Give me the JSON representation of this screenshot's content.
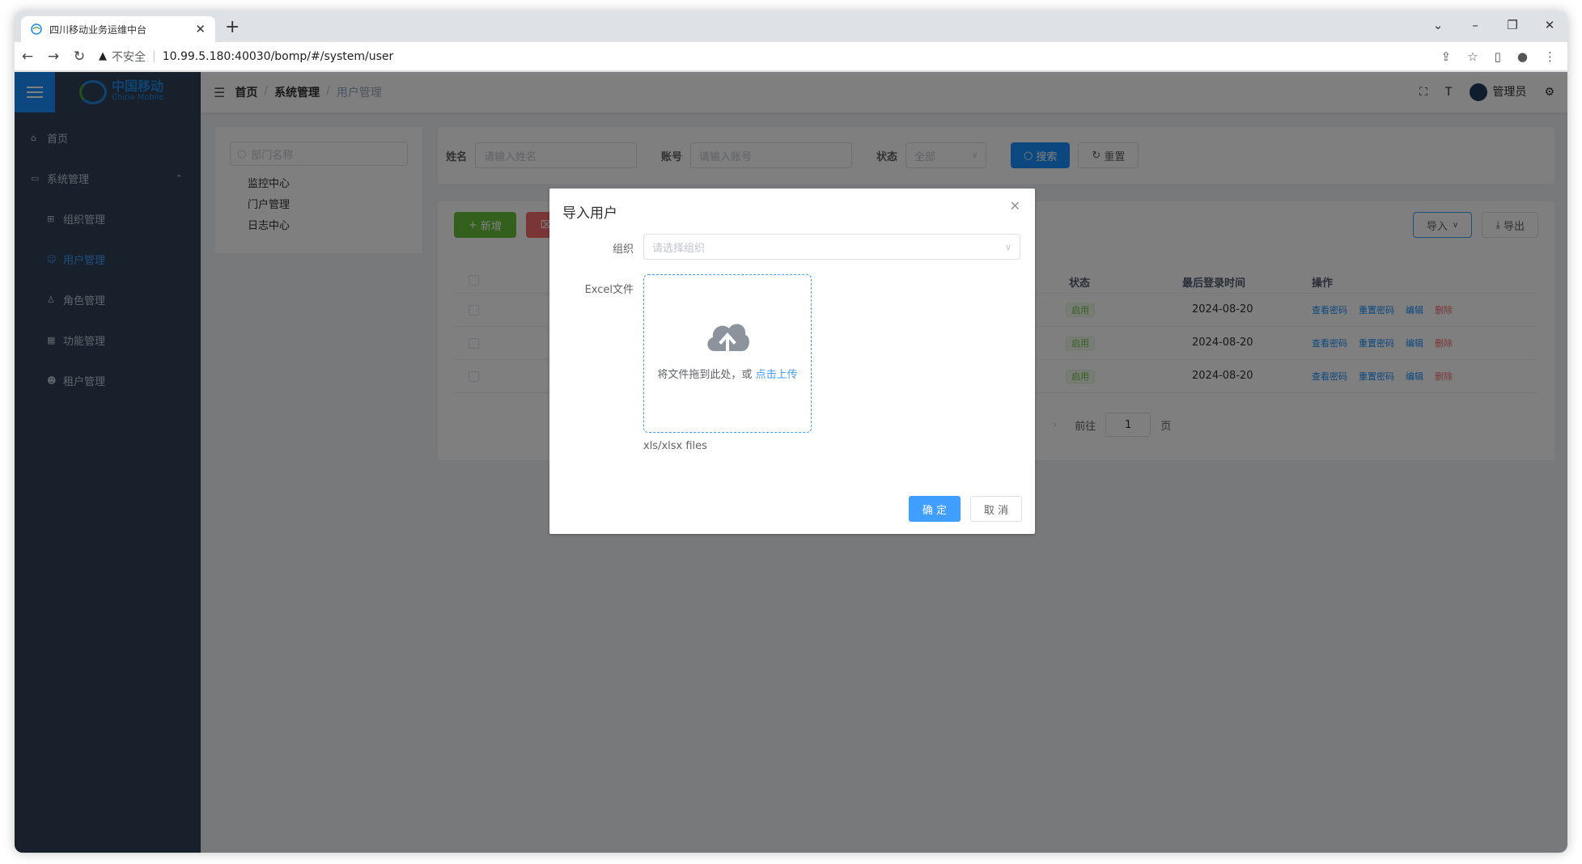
{
  "browser": {
    "tab_title": "四川移动业务运维中台",
    "url_warning": "不安全",
    "url": "10.99.5.180:40030/bomp/#/system/user"
  },
  "logo": {
    "cn": "中国移动",
    "en": "China Mobile"
  },
  "sidebar": {
    "items": [
      {
        "label": "首页"
      },
      {
        "label": "系统管理"
      },
      {
        "label": "组织管理"
      },
      {
        "label": "用户管理"
      },
      {
        "label": "角色管理"
      },
      {
        "label": "功能管理"
      },
      {
        "label": "租户管理"
      }
    ]
  },
  "breadcrumb": [
    "首页",
    "系统管理",
    "用户管理"
  ],
  "navbar": {
    "user": "管理员"
  },
  "dept": {
    "placeholder": "部门名称",
    "nodes": [
      "监控中心",
      "门户管理",
      "日志中心"
    ]
  },
  "search": {
    "name_label": "姓名",
    "name_placeholder": "请输入姓名",
    "account_label": "账号",
    "account_placeholder": "请输入账号",
    "status_label": "状态",
    "status_value": "全部",
    "search_btn": "搜索",
    "reset_btn": "重置"
  },
  "toolbar": {
    "add": "新增",
    "import": "导入",
    "export": "导出"
  },
  "table": {
    "headers": {
      "status": "状态",
      "last_login": "最后登录时间",
      "ops": "操作"
    },
    "rows": [
      {
        "status": "启用",
        "last_login": "2024-08-20"
      },
      {
        "status": "启用",
        "last_login": "2024-08-20"
      },
      {
        "status": "启用",
        "last_login": "2024-08-20"
      }
    ],
    "ops": {
      "view": "查看密码",
      "reset": "重置密码",
      "edit": "编辑",
      "del": "删除"
    }
  },
  "pager": {
    "goto": "前往",
    "page": "1",
    "page_unit": "页"
  },
  "dialog": {
    "title": "导入用户",
    "org_label": "组织",
    "org_placeholder": "请选择组织",
    "file_label": "Excel文件",
    "drop_hint": "将文件拖到此处，或",
    "upload_link": "点击上传",
    "tip": "xls/xlsx files",
    "ok": "确 定",
    "cancel": "取 消"
  }
}
